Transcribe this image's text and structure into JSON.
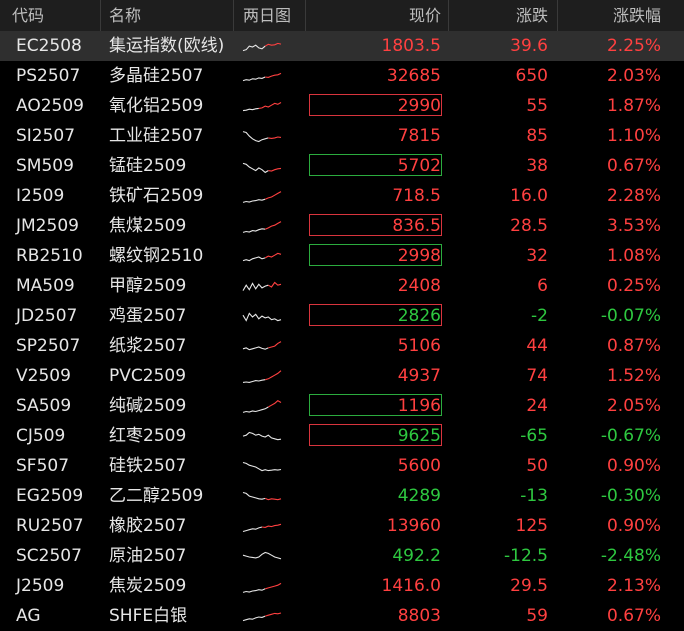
{
  "colors": {
    "up": "#ff4040",
    "down": "#2ec840",
    "up_border": "#d8343d",
    "down_border": "#2bab3e",
    "spark_white": "#e6e6e6",
    "spark_red": "#ff4040"
  },
  "header": {
    "code": "代码",
    "name": "名称",
    "chart": "两日图",
    "price": "现价",
    "change": "涨跌",
    "pct": "涨跌幅"
  },
  "rows": [
    {
      "code": "EC2508",
      "name": "集运指数(欧线)",
      "price": "1803.5",
      "change": "39.6",
      "pct": "2.25%",
      "dir": "up",
      "selected": true,
      "box": "",
      "spark": [
        0.3,
        0.35,
        0.55,
        0.5,
        0.6,
        0.45,
        0.4,
        0.55,
        0.65,
        0.6,
        0.62,
        0.7,
        0.66
      ],
      "split": 8
    },
    {
      "code": "PS2507",
      "name": "多晶硅2507",
      "price": "32685",
      "change": "650",
      "pct": "2.03%",
      "dir": "up",
      "selected": false,
      "box": "",
      "spark": [
        0.3,
        0.35,
        0.32,
        0.4,
        0.38,
        0.45,
        0.42,
        0.5,
        0.48,
        0.55,
        0.6,
        0.62,
        0.7
      ],
      "split": 8
    },
    {
      "code": "AO2509",
      "name": "氧化铝2509",
      "price": "2990",
      "change": "55",
      "pct": "1.87%",
      "dir": "up",
      "selected": false,
      "box": "up",
      "spark": [
        0.3,
        0.32,
        0.38,
        0.35,
        0.4,
        0.42,
        0.45,
        0.55,
        0.5,
        0.6,
        0.7,
        0.65,
        0.75
      ],
      "split": 6
    },
    {
      "code": "SI2507",
      "name": "工业硅2507",
      "price": "7815",
      "change": "85",
      "pct": "1.10%",
      "dir": "up",
      "selected": false,
      "box": "",
      "spark": [
        0.8,
        0.75,
        0.55,
        0.4,
        0.3,
        0.25,
        0.35,
        0.4,
        0.45,
        0.42,
        0.45,
        0.5,
        0.48
      ],
      "split": 9
    },
    {
      "code": "SM509",
      "name": "锰硅2509",
      "price": "5702",
      "change": "38",
      "pct": "0.67%",
      "dir": "up",
      "selected": false,
      "box": "down",
      "spark": [
        0.7,
        0.65,
        0.5,
        0.4,
        0.3,
        0.45,
        0.35,
        0.2,
        0.3,
        0.28,
        0.35,
        0.4,
        0.42
      ],
      "split": 9
    },
    {
      "code": "I2509",
      "name": "铁矿石2509",
      "price": "718.5",
      "change": "16.0",
      "pct": "2.28%",
      "dir": "up",
      "selected": false,
      "box": "",
      "spark": [
        0.2,
        0.25,
        0.22,
        0.28,
        0.3,
        0.35,
        0.32,
        0.38,
        0.45,
        0.5,
        0.6,
        0.7,
        0.8
      ],
      "split": 8
    },
    {
      "code": "JM2509",
      "name": "焦煤2509",
      "price": "836.5",
      "change": "28.5",
      "pct": "3.53%",
      "dir": "up",
      "selected": false,
      "box": "up",
      "spark": [
        0.2,
        0.25,
        0.22,
        0.3,
        0.28,
        0.35,
        0.4,
        0.38,
        0.45,
        0.55,
        0.6,
        0.7,
        0.8
      ],
      "split": 8
    },
    {
      "code": "RB2510",
      "name": "螺纹钢2510",
      "price": "2998",
      "change": "32",
      "pct": "1.08%",
      "dir": "up",
      "selected": false,
      "box": "down",
      "spark": [
        0.3,
        0.35,
        0.3,
        0.4,
        0.45,
        0.5,
        0.4,
        0.45,
        0.55,
        0.5,
        0.6,
        0.7,
        0.65
      ],
      "split": 8
    },
    {
      "code": "MA509",
      "name": "甲醇2509",
      "price": "2408",
      "change": "6",
      "pct": "0.25%",
      "dir": "up",
      "selected": false,
      "box": "",
      "spark": [
        0.3,
        0.6,
        0.35,
        0.7,
        0.4,
        0.65,
        0.45,
        0.55,
        0.6,
        0.5,
        0.75,
        0.6,
        0.65
      ],
      "split": 9
    },
    {
      "code": "JD2507",
      "name": "鸡蛋2507",
      "price": "2826",
      "change": "-2",
      "pct": "-0.07%",
      "dir": "down",
      "selected": false,
      "box": "up",
      "spark": [
        0.6,
        0.3,
        0.7,
        0.5,
        0.65,
        0.4,
        0.55,
        0.45,
        0.5,
        0.35,
        0.4,
        0.3,
        0.35
      ],
      "split": 13
    },
    {
      "code": "SP2507",
      "name": "纸浆2507",
      "price": "5106",
      "change": "44",
      "pct": "0.87%",
      "dir": "up",
      "selected": false,
      "box": "",
      "spark": [
        0.4,
        0.45,
        0.35,
        0.4,
        0.45,
        0.5,
        0.42,
        0.38,
        0.45,
        0.5,
        0.55,
        0.7,
        0.8
      ],
      "split": 9
    },
    {
      "code": "V2509",
      "name": "PVC2509",
      "price": "4937",
      "change": "74",
      "pct": "1.52%",
      "dir": "up",
      "selected": false,
      "box": "",
      "spark": [
        0.2,
        0.22,
        0.2,
        0.25,
        0.3,
        0.28,
        0.32,
        0.35,
        0.4,
        0.5,
        0.6,
        0.7,
        0.85
      ],
      "split": 8
    },
    {
      "code": "SA509",
      "name": "纯碱2509",
      "price": "1196",
      "change": "24",
      "pct": "2.05%",
      "dir": "up",
      "selected": false,
      "box": "down",
      "spark": [
        0.2,
        0.25,
        0.22,
        0.28,
        0.25,
        0.3,
        0.35,
        0.4,
        0.5,
        0.6,
        0.7,
        0.85,
        0.75
      ],
      "split": 9
    },
    {
      "code": "CJ509",
      "name": "红枣2509",
      "price": "9625",
      "change": "-65",
      "pct": "-0.67%",
      "dir": "down",
      "selected": false,
      "box": "up",
      "spark": [
        0.55,
        0.6,
        0.75,
        0.7,
        0.6,
        0.65,
        0.55,
        0.5,
        0.6,
        0.45,
        0.4,
        0.35,
        0.38
      ],
      "split": 13
    },
    {
      "code": "SF507",
      "name": "硅铁2507",
      "price": "5600",
      "change": "50",
      "pct": "0.90%",
      "dir": "up",
      "selected": false,
      "box": "",
      "spark": [
        0.75,
        0.7,
        0.6,
        0.55,
        0.5,
        0.4,
        0.3,
        0.35,
        0.3,
        0.32,
        0.35,
        0.33,
        0.36
      ],
      "split": 13
    },
    {
      "code": "EG2509",
      "name": "乙二醇2509",
      "price": "4289",
      "change": "-13",
      "pct": "-0.30%",
      "dir": "down",
      "selected": false,
      "box": "",
      "spark": [
        0.75,
        0.7,
        0.55,
        0.5,
        0.45,
        0.4,
        0.38,
        0.42,
        0.35,
        0.4,
        0.38,
        0.35,
        0.4
      ],
      "split": 8
    },
    {
      "code": "RU2507",
      "name": "橡胶2507",
      "price": "13960",
      "change": "125",
      "pct": "0.90%",
      "dir": "up",
      "selected": false,
      "box": "",
      "spark": [
        0.25,
        0.3,
        0.35,
        0.4,
        0.38,
        0.45,
        0.5,
        0.48,
        0.55,
        0.52,
        0.58,
        0.6,
        0.65
      ],
      "split": 7
    },
    {
      "code": "SC2507",
      "name": "原油2507",
      "price": "492.2",
      "change": "-12.5",
      "pct": "-2.48%",
      "dir": "down",
      "selected": false,
      "box": "",
      "spark": [
        0.6,
        0.55,
        0.5,
        0.48,
        0.45,
        0.5,
        0.65,
        0.75,
        0.7,
        0.6,
        0.5,
        0.45,
        0.4
      ],
      "split": 13
    },
    {
      "code": "J2509",
      "name": "焦炭2509",
      "price": "1416.0",
      "change": "29.5",
      "pct": "2.13%",
      "dir": "up",
      "selected": false,
      "box": "",
      "spark": [
        0.2,
        0.25,
        0.22,
        0.28,
        0.3,
        0.35,
        0.32,
        0.4,
        0.45,
        0.5,
        0.55,
        0.6,
        0.7
      ],
      "split": 8
    },
    {
      "code": "AG",
      "name": "SHFE白银",
      "price": "8803",
      "change": "59",
      "pct": "0.67%",
      "dir": "up",
      "selected": false,
      "box": "",
      "spark": [
        0.3,
        0.35,
        0.4,
        0.38,
        0.45,
        0.5,
        0.48,
        0.55,
        0.6,
        0.65,
        0.7,
        0.68,
        0.72
      ],
      "split": 8
    }
  ]
}
